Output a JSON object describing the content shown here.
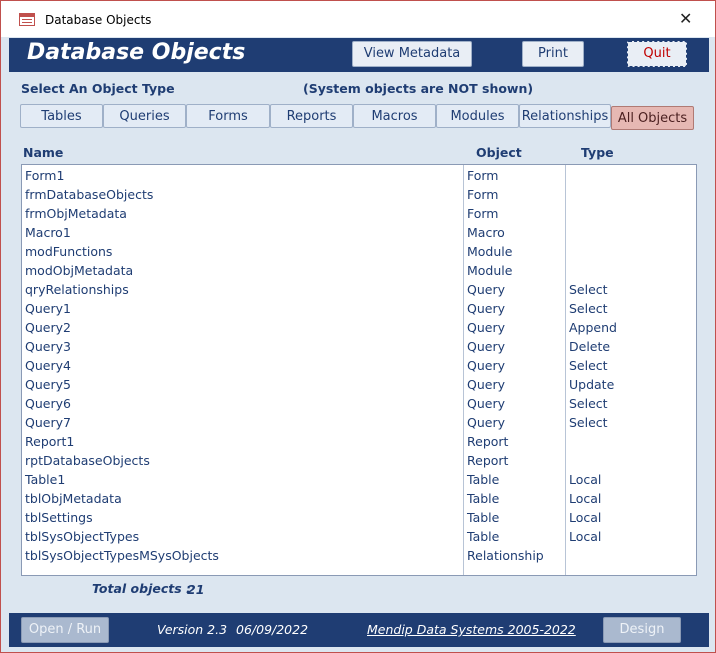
{
  "window": {
    "title": "Database Objects"
  },
  "header": {
    "title": "Database Objects",
    "view_metadata_label": "View Metadata",
    "print_label": "Print",
    "quit_label": "Quit"
  },
  "filter": {
    "select_label": "Select An Object Type",
    "system_note": "(System objects are NOT shown)",
    "tabs": [
      "Tables",
      "Queries",
      "Forms",
      "Reports",
      "Macros",
      "Modules",
      "Relationships",
      "All Objects"
    ],
    "active_tab": "All Objects"
  },
  "list": {
    "headers": {
      "name": "Name",
      "object": "Object",
      "type": "Type"
    },
    "rows": [
      {
        "name": "Form1",
        "object": "Form",
        "type": ""
      },
      {
        "name": "frmDatabaseObjects",
        "object": "Form",
        "type": ""
      },
      {
        "name": "frmObjMetadata",
        "object": "Form",
        "type": ""
      },
      {
        "name": "Macro1",
        "object": "Macro",
        "type": ""
      },
      {
        "name": "modFunctions",
        "object": "Module",
        "type": ""
      },
      {
        "name": "modObjMetadata",
        "object": "Module",
        "type": ""
      },
      {
        "name": "qryRelationships",
        "object": "Query",
        "type": "Select"
      },
      {
        "name": "Query1",
        "object": "Query",
        "type": "Select"
      },
      {
        "name": "Query2",
        "object": "Query",
        "type": "Append"
      },
      {
        "name": "Query3",
        "object": "Query",
        "type": "Delete"
      },
      {
        "name": "Query4",
        "object": "Query",
        "type": "Select"
      },
      {
        "name": "Query5",
        "object": "Query",
        "type": "Update"
      },
      {
        "name": "Query6",
        "object": "Query",
        "type": "Select"
      },
      {
        "name": "Query7",
        "object": "Query",
        "type": "Select"
      },
      {
        "name": "Report1",
        "object": "Report",
        "type": ""
      },
      {
        "name": "rptDatabaseObjects",
        "object": "Report",
        "type": ""
      },
      {
        "name": "Table1",
        "object": "Table",
        "type": "Local"
      },
      {
        "name": "tblObjMetadata",
        "object": "Table",
        "type": "Local"
      },
      {
        "name": "tblSettings",
        "object": "Table",
        "type": "Local"
      },
      {
        "name": "tblSysObjectTypes",
        "object": "Table",
        "type": "Local"
      },
      {
        "name": "tblSysObjectTypesMSysObjects",
        "object": "Relationship",
        "type": ""
      }
    ]
  },
  "total": {
    "label": "Total objects :",
    "value": "21"
  },
  "footer": {
    "open_run_label": "Open / Run",
    "version": "Version 2.3",
    "date": "06/09/2022",
    "copyright": "Mendip Data Systems 2005-2022",
    "design_label": "Design"
  },
  "colors": {
    "band": "#1f3d73",
    "background": "#dce6f0",
    "active_tab": "#e6b8b3",
    "quit_text": "#c00000"
  }
}
